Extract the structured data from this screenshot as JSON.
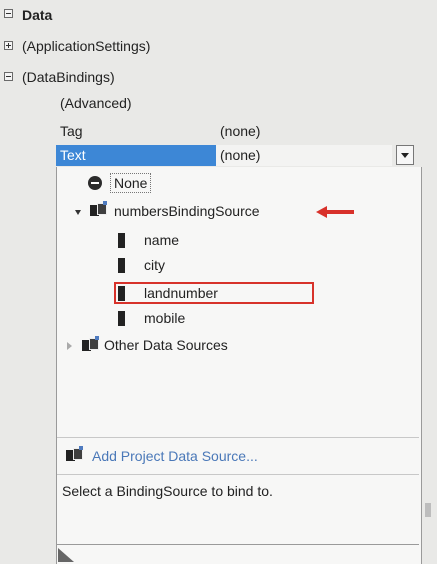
{
  "grid": {
    "category_data": "Data",
    "application_settings": "(ApplicationSettings)",
    "data_bindings": "(DataBindings)",
    "advanced": "(Advanced)",
    "tag_label": "Tag",
    "tag_value": "(none)",
    "text_label": "Text",
    "text_value": "(none)"
  },
  "dropdown": {
    "none_label": "None",
    "binding_source": "numbersBindingSource",
    "fields": [
      "name",
      "city",
      "landnumber",
      "mobile"
    ],
    "other_sources": "Other Data Sources",
    "add_project_source": "Add Project Data Source...",
    "status_text": "Select a BindingSource to bind to."
  },
  "colors": {
    "selection": "#3d87d6",
    "annotation": "#d8312a",
    "link": "#4a78b8"
  }
}
